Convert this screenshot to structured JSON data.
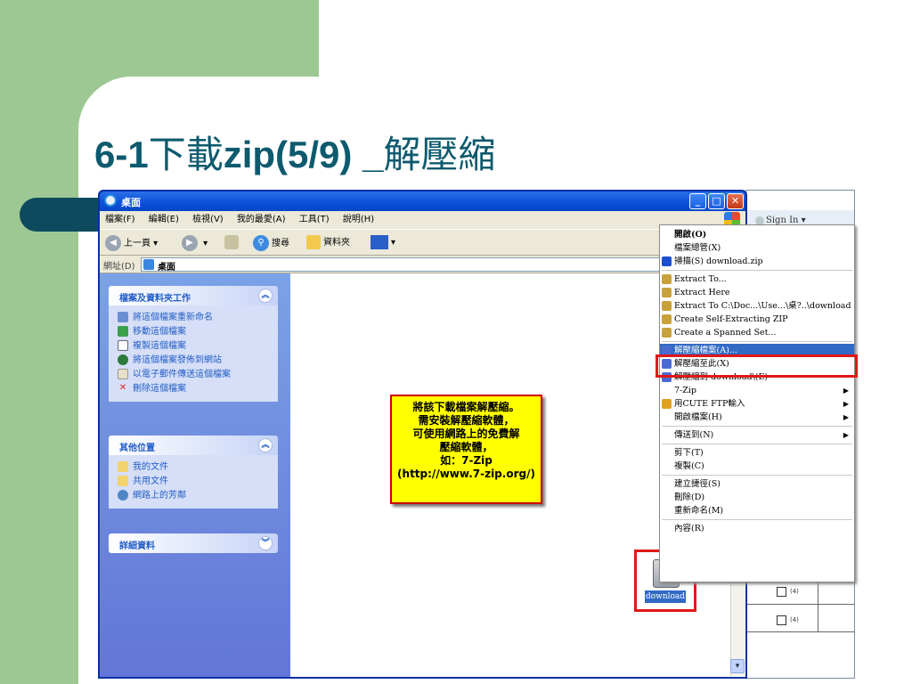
{
  "slide": {
    "title_latin": "6-1",
    "title_cjk": "下載",
    "title_latin2": "zip(5/9) _",
    "title_cjk2": "解壓縮"
  },
  "window": {
    "title": "桌面",
    "menu": [
      "檔案(F)",
      "編輯(E)",
      "檢視(V)",
      "我的最愛(A)",
      "工具(T)",
      "說明(H)"
    ],
    "toolbar": {
      "back": "上一頁",
      "search": "搜尋",
      "folders": "資料夾"
    },
    "address": {
      "label": "網址(D)",
      "value": "桌面"
    }
  },
  "left_pane": {
    "tasks": {
      "title": "檔案及資料夾工作",
      "items": [
        "將這個檔案重新命名",
        "移動這個檔案",
        "複製這個檔案",
        "將這個檔案發佈到網站",
        "以電子郵件傳送這個檔案",
        "刪除這個檔案"
      ]
    },
    "other": {
      "title": "其他位置",
      "items": [
        "我的文件",
        "共用文件",
        "網路上的芳鄰"
      ]
    },
    "details": {
      "title": "詳細資料"
    }
  },
  "callout": {
    "lines": [
      "將該下載檔案解壓縮。",
      "需安裝解壓縮軟體，",
      "可使用網路上的免費解",
      "壓縮軟體，",
      "如：7-Zip",
      "(http://www.7-zip.org/)"
    ]
  },
  "file": {
    "label": "download"
  },
  "bg_browser": {
    "signin": "Sign In",
    "checkbox_label": "(4)"
  },
  "context_menu": {
    "items": [
      {
        "label": "開啟(O)",
        "bold": true
      },
      {
        "label": "檔案總管(X)"
      },
      {
        "label": "掃描(S) download.zip",
        "icon": "#1b4fd1"
      },
      {
        "sep": true
      },
      {
        "label": "Extract To...",
        "icon": "#c9a13a"
      },
      {
        "label": "Extract Here",
        "icon": "#c9a13a"
      },
      {
        "label": "Extract To C:\\Doc...\\Use...\\桌?..\\download",
        "icon": "#c9a13a"
      },
      {
        "label": "Create Self-Extracting ZIP",
        "icon": "#c9a13a"
      },
      {
        "label": "Create a Spanned Set...",
        "icon": "#c9a13a"
      },
      {
        "sep": true
      },
      {
        "label": "解壓縮檔案(A)...",
        "icon": "#4a6bd1",
        "highlight": true
      },
      {
        "label": "解壓縮至此(X)",
        "icon": "#4a6bd1"
      },
      {
        "label": "解壓縮到 download\\(E)",
        "icon": "#4a6bd1"
      },
      {
        "label": "7-Zip",
        "submenu": true
      },
      {
        "label": "用CUTE FTP輸入",
        "icon": "#e0a020",
        "submenu": true
      },
      {
        "label": "開啟檔案(H)",
        "submenu": true
      },
      {
        "sep": true
      },
      {
        "label": "傳送到(N)",
        "submenu": true
      },
      {
        "sep": true
      },
      {
        "label": "剪下(T)"
      },
      {
        "label": "複製(C)"
      },
      {
        "sep": true
      },
      {
        "label": "建立捷徑(S)"
      },
      {
        "label": "刪除(D)"
      },
      {
        "label": "重新命名(M)"
      },
      {
        "sep": true
      },
      {
        "label": "內容(R)"
      }
    ]
  }
}
